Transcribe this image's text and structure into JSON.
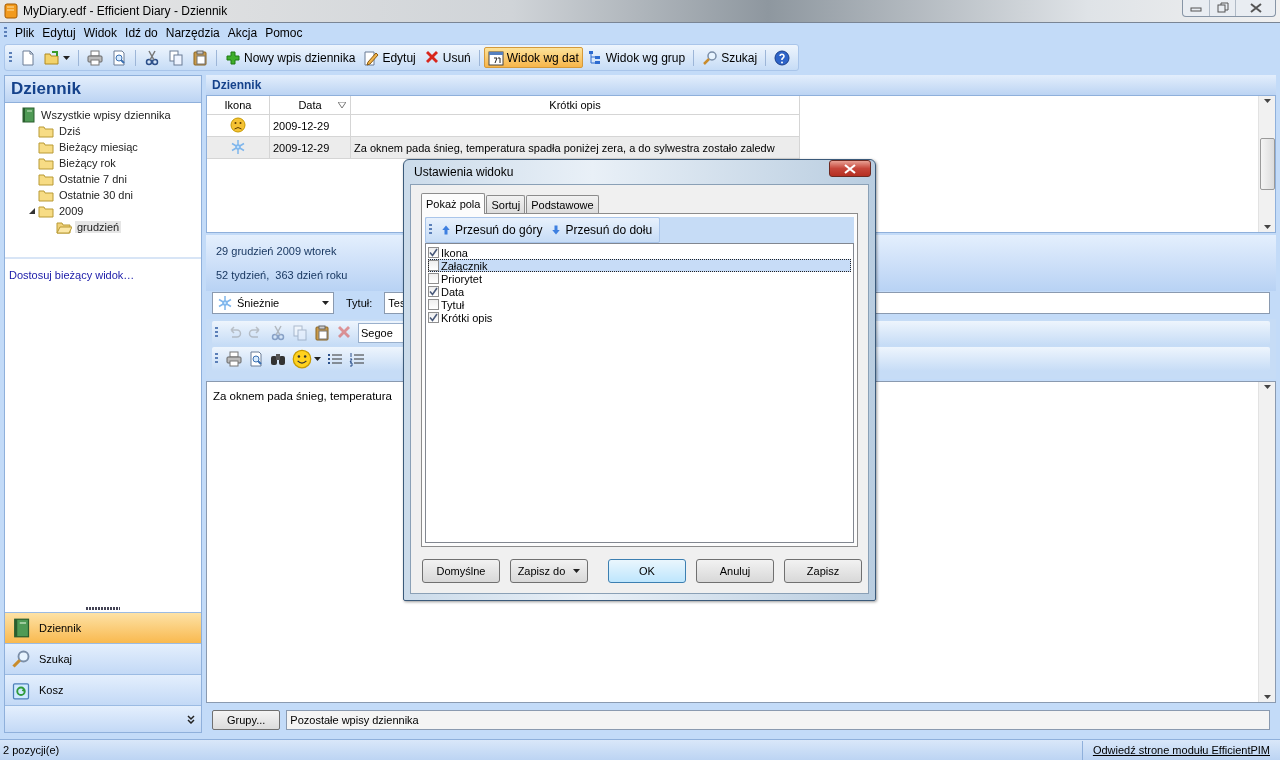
{
  "window": {
    "title": "MyDiary.edf - Efficient Diary - Dziennik"
  },
  "menu": [
    "Plik",
    "Edytuj",
    "Widok",
    "Idź do",
    "Narzędzia",
    "Akcja",
    "Pomoc"
  ],
  "toolbar": {
    "groups": [
      [
        {
          "kind": "new",
          "selected": false
        },
        {
          "kind": "open",
          "selected": false,
          "menu": true
        }
      ],
      [
        {
          "kind": "print",
          "selected": false
        },
        {
          "kind": "preview",
          "selected": false
        }
      ],
      [
        {
          "kind": "cut",
          "selected": false
        },
        {
          "kind": "copy",
          "selected": false
        },
        {
          "kind": "paste",
          "selected": false
        }
      ],
      [
        {
          "kind": "add",
          "label": "Nowy wpis dziennika",
          "selected": false
        },
        {
          "kind": "edit",
          "label": "Edytuj",
          "selected": false
        },
        {
          "kind": "delete",
          "label": "Usuń",
          "selected": false
        }
      ],
      [
        {
          "kind": "calendar",
          "label": "Widok wg dat",
          "selected": true
        },
        {
          "kind": "tree",
          "label": "Widok wg grup",
          "selected": false
        }
      ],
      [
        {
          "kind": "search",
          "label": "Szukaj",
          "selected": false
        }
      ],
      [
        {
          "kind": "help",
          "selected": false
        }
      ]
    ]
  },
  "sidebar": {
    "title": "Dziennik",
    "tree": [
      {
        "label": "Wszystkie wpisy dziennika",
        "kind": "book",
        "selected": false,
        "children": [
          {
            "label": "Dziś",
            "kind": "folder",
            "selected": false
          },
          {
            "label": "Bieżący miesiąc",
            "kind": "folder",
            "selected": false
          },
          {
            "label": "Bieżący rok",
            "kind": "folder",
            "selected": false
          },
          {
            "label": "Ostatnie 7 dni",
            "kind": "folder",
            "selected": false
          },
          {
            "label": "Ostatnie 30 dni",
            "kind": "folder",
            "selected": false
          },
          {
            "label": "2009",
            "kind": "folder",
            "selected": false,
            "expanded": true,
            "children": [
              {
                "label": "grudzień",
                "kind": "folder-open",
                "selected": true
              }
            ]
          }
        ]
      }
    ],
    "customize_link": "Dostosuj bieżący widok…",
    "nav": [
      {
        "label": "Dziennik",
        "kind": "book",
        "selected": true
      },
      {
        "label": "Szukaj",
        "kind": "search",
        "selected": false
      },
      {
        "label": "Kosz",
        "kind": "recycle",
        "selected": false
      }
    ]
  },
  "content": {
    "title": "Dziennik",
    "table": {
      "columns": [
        {
          "label": "Ikona",
          "sorted": false
        },
        {
          "label": "Data",
          "sorted": true
        },
        {
          "label": "Krótki opis",
          "sorted": false
        }
      ],
      "rows": [
        {
          "kind": "sad",
          "date": "2009-12-29",
          "selected": false
        },
        {
          "kind": "snow",
          "date": "2009-12-29",
          "summary": "Za oknem pada śnieg, temperatura spadła poniżej zera, a do sylwestra zostało zaledw",
          "selected": true
        }
      ]
    },
    "info": [
      "29 grudzień 2009 wtorek",
      "52 tydzień,  363 dzień roku"
    ],
    "mood": {
      "kind": "snow",
      "label": "Śnieżnie"
    },
    "title_label": "Tytuł:",
    "title_value": "Tes",
    "format_toolbar": [
      {
        "kind": "undo",
        "disabled": true
      },
      {
        "kind": "redo",
        "disabled": true
      },
      {
        "kind": "cut",
        "disabled": true
      },
      {
        "kind": "copy",
        "disabled": true
      },
      {
        "kind": "paste",
        "disabled": false
      },
      {
        "kind": "delete",
        "disabled": true
      }
    ],
    "font": "Segoe",
    "insert_toolbar": [
      {
        "kind": "print",
        "disabled": false
      },
      {
        "kind": "preview",
        "disabled": false
      },
      {
        "kind": "find",
        "disabled": false
      },
      {
        "kind": "smile",
        "disabled": false,
        "menu": true
      },
      {
        "kind": "bullets",
        "disabled": false
      },
      {
        "kind": "numbers",
        "disabled": false
      }
    ],
    "text": "Za oknem pada śnieg, temperatura",
    "groups_button": "Grupy...",
    "groups_value": "Pozostałe wpisy dziennika"
  },
  "dialog": {
    "title": "Ustawienia widoku",
    "tabs": [
      {
        "label": "Pokaż pola",
        "selected": true
      },
      {
        "label": "Sortuj",
        "selected": false
      },
      {
        "label": "Podstawowe",
        "selected": false
      }
    ],
    "actions": [
      {
        "label": "Przesuń do góry",
        "kind": "up"
      },
      {
        "label": "Przesuń do dołu",
        "kind": "down"
      }
    ],
    "fields": [
      {
        "label": "Ikona",
        "checked": true,
        "selected": false
      },
      {
        "label": "Załącznik",
        "checked": false,
        "selected": true
      },
      {
        "label": "Priorytet",
        "checked": false,
        "selected": false
      },
      {
        "label": "Data",
        "checked": true,
        "selected": false
      },
      {
        "label": "Tytuł",
        "checked": false,
        "selected": false
      },
      {
        "label": "Krótki opis",
        "checked": true,
        "selected": false
      }
    ],
    "buttons": [
      {
        "label": "Domyślne",
        "menu": false,
        "default": false
      },
      {
        "label": "Zapisz do",
        "menu": true,
        "default": false
      },
      {
        "label": "OK",
        "menu": false,
        "default": true
      },
      {
        "label": "Anuluj",
        "menu": false,
        "default": false
      },
      {
        "label": "Zapisz",
        "menu": false,
        "default": false
      }
    ]
  },
  "status": {
    "count": "2 pozycji(e)",
    "link": "Odwiedź strone modułu EfficientPIM"
  }
}
